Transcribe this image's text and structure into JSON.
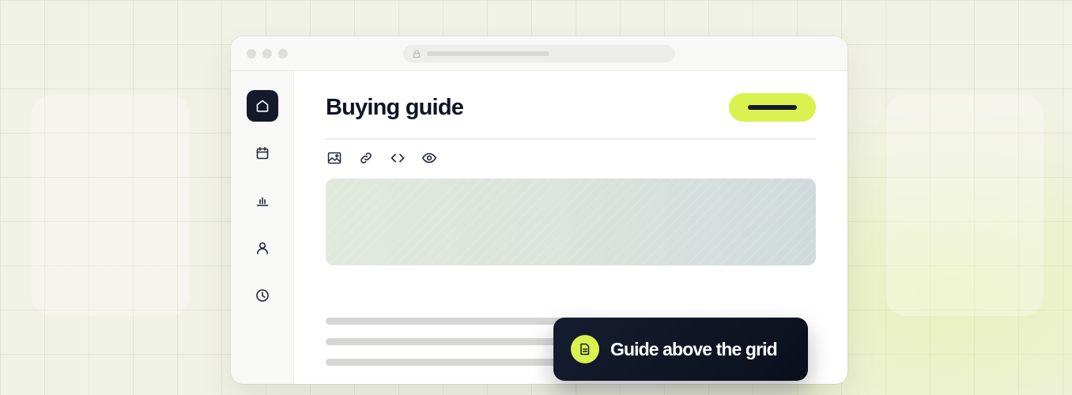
{
  "page": {
    "title": "Buying guide"
  },
  "toast": {
    "text": "Guide above the grid",
    "icon": "document-icon"
  },
  "sidebar": {
    "items": [
      {
        "name": "home",
        "icon": "home-icon",
        "active": true
      },
      {
        "name": "calendar",
        "icon": "calendar-icon",
        "active": false
      },
      {
        "name": "stats",
        "icon": "bar-chart-icon",
        "active": false
      },
      {
        "name": "profile",
        "icon": "user-icon",
        "active": false
      },
      {
        "name": "history",
        "icon": "clock-icon",
        "active": false
      }
    ]
  },
  "toolbar": {
    "items": [
      {
        "name": "image",
        "icon": "image-icon"
      },
      {
        "name": "link",
        "icon": "link-icon"
      },
      {
        "name": "code",
        "icon": "code-icon"
      },
      {
        "name": "preview",
        "icon": "eye-icon"
      }
    ]
  },
  "colors": {
    "accent": "#d9f24f",
    "dark": "#141a2c",
    "background": "#f1f2e6"
  }
}
